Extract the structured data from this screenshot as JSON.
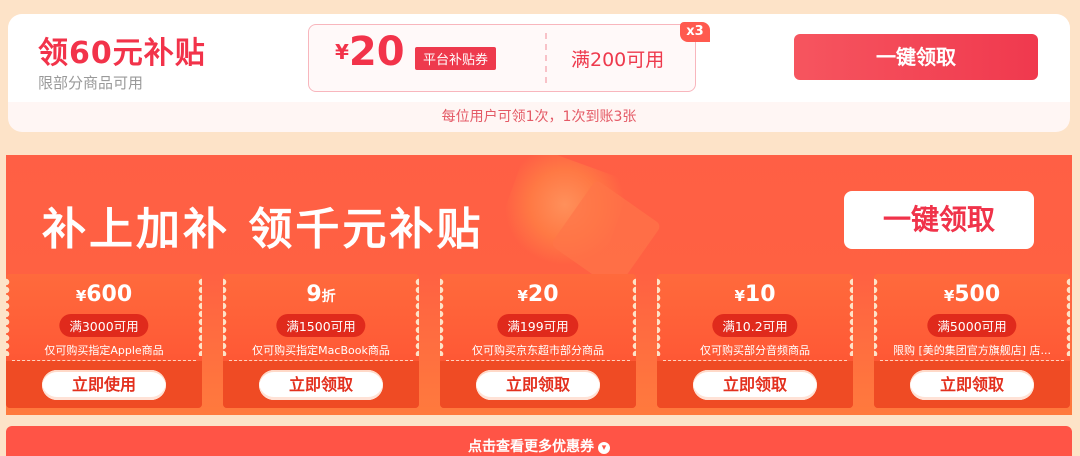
{
  "top_card": {
    "title": "领60元补贴",
    "subtitle": "限部分商品可用",
    "ticket": {
      "currency": "¥",
      "amount": "20",
      "tag": "平台补贴券",
      "condition": "满200可用",
      "multiplier": "x3"
    },
    "claim_button": "一键领取",
    "note": "每位用户可领1次，1次到账3张"
  },
  "banner": {
    "title": "补上加补 领千元补贴",
    "claim_button": "一键领取"
  },
  "coupons": [
    {
      "currency": "¥",
      "amount": "600",
      "unit": "",
      "condition": "满3000可用",
      "desc": "仅可购买指定Apple商品",
      "button": "立即使用"
    },
    {
      "currency": "",
      "amount": "9",
      "unit": "折",
      "condition": "满1500可用",
      "desc": "仅可购买指定MacBook商品",
      "button": "立即领取"
    },
    {
      "currency": "¥",
      "amount": "20",
      "unit": "",
      "condition": "满199可用",
      "desc": "仅可购买京东超市部分商品",
      "button": "立即领取"
    },
    {
      "currency": "¥",
      "amount": "10",
      "unit": "",
      "condition": "满10.2可用",
      "desc": "仅可购买部分音频商品",
      "button": "立即领取"
    },
    {
      "currency": "¥",
      "amount": "500",
      "unit": "",
      "condition": "满5000可用",
      "desc": "限购 [美的集团官方旗舰店] 店...",
      "button": "立即领取"
    }
  ],
  "bottom_strip": {
    "text": "点击查看更多优惠券",
    "icon": "chevron-down-icon"
  }
}
